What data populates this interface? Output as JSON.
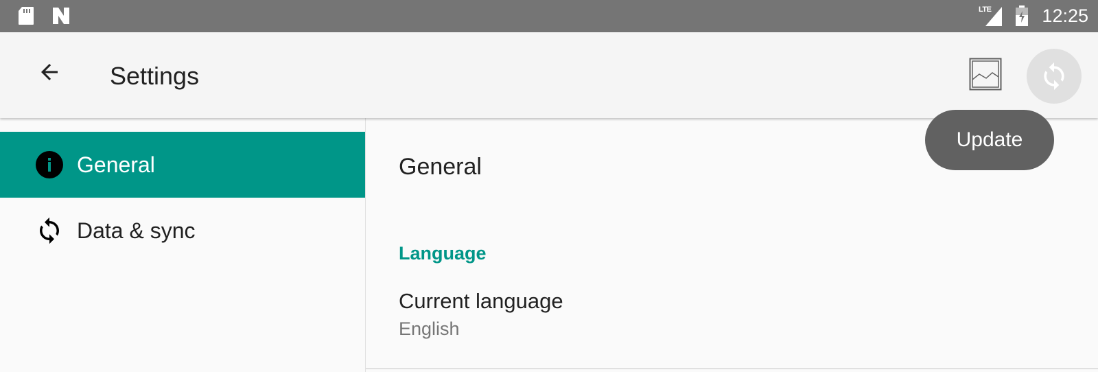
{
  "status_bar": {
    "icons": [
      "sd-card-icon",
      "n-logo-icon",
      "signal-icon",
      "battery-icon"
    ],
    "network": "LTE",
    "time": "12:25"
  },
  "toolbar": {
    "title": "Settings",
    "back_icon": "arrow-left-icon",
    "image_icon": "image-icon",
    "sync_icon": "sync-icon"
  },
  "tooltip": {
    "text": "Update"
  },
  "sidebar": {
    "items": [
      {
        "label": "General",
        "icon": "info-icon",
        "active": true
      },
      {
        "label": "Data & sync",
        "icon": "sync-icon",
        "active": false
      }
    ]
  },
  "content": {
    "title": "General",
    "category": "Language",
    "preference": {
      "title": "Current language",
      "summary": "English"
    }
  },
  "colors": {
    "accent": "#009688",
    "status_bar": "#757575",
    "toolbar": "#f5f5f5",
    "tooltip": "#616161"
  }
}
